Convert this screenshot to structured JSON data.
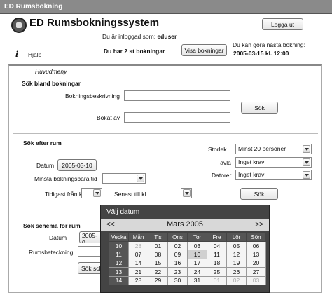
{
  "window": {
    "title": "ED Rumsbokning"
  },
  "header": {
    "app_title": "ED Rumsbokningssystem",
    "logged_in_prefix": "Du är inloggad som:",
    "username": "eduser",
    "bookings_text": "Du har 2 st bokningar",
    "logout_label": "Logga ut",
    "show_bookings_label": "Visa bokningar",
    "next_booking_label": "Du kan göra nästa bokning:",
    "next_booking_date": "2005-03-15 kl. 12:00",
    "help_label": "Hjälp"
  },
  "menu_label": "Huvudmeny",
  "search_bookings": {
    "title": "Sök bland bokningar",
    "description_label": "Bokningsbeskrivning",
    "description_value": "",
    "booked_by_label": "Bokat av",
    "booked_by_value": "",
    "search_label": "Sök"
  },
  "search_rooms": {
    "title": "Sök efter rum",
    "date_label": "Datum",
    "date_value": "2005-03-10",
    "min_time_label": "Minsta bokningsbara tid",
    "min_time_value": "",
    "earliest_label": "Tidigast från kl.",
    "earliest_value": "",
    "latest_label": "Senast till kl.",
    "latest_value": "",
    "size_label": "Storlek",
    "size_value": "Minst 20 personer",
    "board_label": "Tavla",
    "board_value": "Inget krav",
    "computer_label": "Datorer",
    "computer_value": "Inget krav",
    "search_label": "Sök"
  },
  "search_schedule": {
    "title": "Sök schema för rum",
    "date_label": "Datum",
    "date_value": "2005-0",
    "room_label": "Rumsbeteckning",
    "search_label": "Sök sch"
  },
  "date_picker": {
    "title": "Välj datum",
    "prev": "<<",
    "next": ">>",
    "month": "Mars 2005",
    "headers": [
      "Vecka",
      "Mån",
      "Tis",
      "Ons",
      "Tor",
      "Fre",
      "Lör",
      "Sön"
    ],
    "weeks": [
      [
        "10",
        "28",
        "01",
        "02",
        "03",
        "04",
        "05",
        "06"
      ],
      [
        "11",
        "07",
        "08",
        "09",
        "10",
        "11",
        "12",
        "13"
      ],
      [
        "12",
        "14",
        "15",
        "16",
        "17",
        "18",
        "19",
        "20"
      ],
      [
        "13",
        "21",
        "22",
        "23",
        "24",
        "25",
        "26",
        "27"
      ],
      [
        "14",
        "28",
        "29",
        "30",
        "31",
        "01",
        "02",
        "03"
      ]
    ]
  }
}
